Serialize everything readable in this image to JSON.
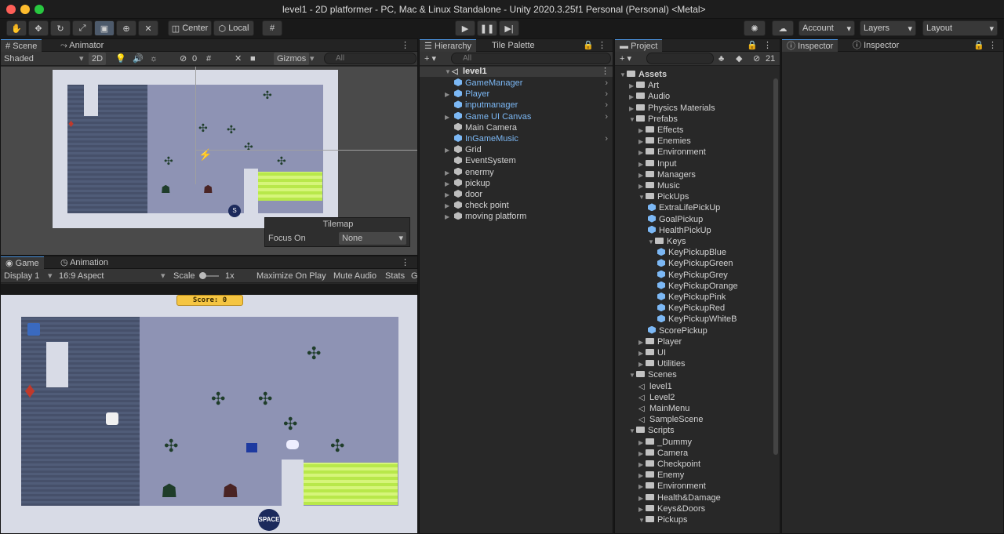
{
  "window": {
    "title": "level1 - 2D platformer - PC, Mac & Linux Standalone - Unity 2020.3.25f1 Personal (Personal) <Metal>"
  },
  "toolbar": {
    "center": "Center",
    "local": "Local",
    "account": "Account",
    "layers": "Layers",
    "layout": "Layout"
  },
  "scene": {
    "tab": "Scene",
    "tab2": "Animator",
    "shaded": "Shaded",
    "mode2d": "2D",
    "hidden_count": "0",
    "gizmos": "Gizmos",
    "search": "All",
    "tilemap": {
      "title": "Tilemap",
      "focus_label": "Focus On",
      "focus_value": "None"
    }
  },
  "game": {
    "tab": "Game",
    "tab2": "Animation",
    "display": "Display 1",
    "aspect": "16:9 Aspect",
    "scale_label": "Scale",
    "scale_value": "1x",
    "maximize": "Maximize On Play",
    "mute": "Mute Audio",
    "stats": "Stats",
    "gizmos": "Gi",
    "score": "Score: 0",
    "space": "SPACE"
  },
  "hierarchy": {
    "tab": "Hierarchy",
    "tab2": "Tile Palette",
    "search": "All",
    "scene": "level1",
    "items": [
      {
        "label": "GameManager",
        "blue": true,
        "arrow": false,
        "chev": true
      },
      {
        "label": "Player",
        "blue": true,
        "arrow": true,
        "chev": true
      },
      {
        "label": "inputmanager",
        "blue": true,
        "arrow": false,
        "chev": true
      },
      {
        "label": "Game UI Canvas",
        "blue": true,
        "arrow": true,
        "chev": true
      },
      {
        "label": "Main Camera",
        "blue": false,
        "arrow": false,
        "chev": false
      },
      {
        "label": "InGameMusic",
        "blue": true,
        "arrow": false,
        "chev": true
      },
      {
        "label": "Grid",
        "blue": false,
        "arrow": true,
        "chev": false
      },
      {
        "label": "EventSystem",
        "blue": false,
        "arrow": false,
        "chev": false
      },
      {
        "label": "enermy",
        "blue": false,
        "arrow": true,
        "chev": false
      },
      {
        "label": "pickup",
        "blue": false,
        "arrow": true,
        "chev": false
      },
      {
        "label": "door",
        "blue": false,
        "arrow": true,
        "chev": false
      },
      {
        "label": "check point",
        "blue": false,
        "arrow": true,
        "chev": false
      },
      {
        "label": "moving platform",
        "blue": false,
        "arrow": true,
        "chev": false
      }
    ]
  },
  "project": {
    "tab": "Project",
    "count": "21",
    "items": [
      {
        "label": "Assets",
        "depth": 0,
        "type": "root",
        "open": true
      },
      {
        "label": "Art",
        "depth": 1,
        "type": "folder",
        "open": false
      },
      {
        "label": "Audio",
        "depth": 1,
        "type": "folder",
        "open": false
      },
      {
        "label": "Physics Materials",
        "depth": 1,
        "type": "folder",
        "open": false
      },
      {
        "label": "Prefabs",
        "depth": 1,
        "type": "folder",
        "open": true
      },
      {
        "label": "Effects",
        "depth": 2,
        "type": "folder",
        "open": false
      },
      {
        "label": "Enemies",
        "depth": 2,
        "type": "folder",
        "open": false
      },
      {
        "label": "Environment",
        "depth": 2,
        "type": "folder",
        "open": false
      },
      {
        "label": "Input",
        "depth": 2,
        "type": "folder",
        "open": false
      },
      {
        "label": "Managers",
        "depth": 2,
        "type": "folder",
        "open": false
      },
      {
        "label": "Music",
        "depth": 2,
        "type": "folder",
        "open": false
      },
      {
        "label": "PickUps",
        "depth": 2,
        "type": "folder",
        "open": true
      },
      {
        "label": "ExtraLifePickUp",
        "depth": 3,
        "type": "prefab"
      },
      {
        "label": "GoalPickup",
        "depth": 3,
        "type": "prefab"
      },
      {
        "label": "HealthPickUp",
        "depth": 3,
        "type": "prefab"
      },
      {
        "label": "Keys",
        "depth": 3,
        "type": "folder",
        "open": true
      },
      {
        "label": "KeyPickupBlue",
        "depth": 4,
        "type": "prefab"
      },
      {
        "label": "KeyPickupGreen",
        "depth": 4,
        "type": "prefab"
      },
      {
        "label": "KeyPickupGrey",
        "depth": 4,
        "type": "prefab"
      },
      {
        "label": "KeyPickupOrange",
        "depth": 4,
        "type": "prefab"
      },
      {
        "label": "KeyPickupPink",
        "depth": 4,
        "type": "prefab"
      },
      {
        "label": "KeyPickupRed",
        "depth": 4,
        "type": "prefab"
      },
      {
        "label": "KeyPickupWhiteB",
        "depth": 4,
        "type": "prefab"
      },
      {
        "label": "ScorePickup",
        "depth": 3,
        "type": "prefab"
      },
      {
        "label": "Player",
        "depth": 2,
        "type": "folder",
        "open": false
      },
      {
        "label": "UI",
        "depth": 2,
        "type": "folder",
        "open": false
      },
      {
        "label": "Utilities",
        "depth": 2,
        "type": "folder",
        "open": false
      },
      {
        "label": "Scenes",
        "depth": 1,
        "type": "folder",
        "open": true
      },
      {
        "label": "level1",
        "depth": 2,
        "type": "scene"
      },
      {
        "label": "Level2",
        "depth": 2,
        "type": "scene"
      },
      {
        "label": "MainMenu",
        "depth": 2,
        "type": "scene"
      },
      {
        "label": "SampleScene",
        "depth": 2,
        "type": "scene"
      },
      {
        "label": "Scripts",
        "depth": 1,
        "type": "folder",
        "open": true
      },
      {
        "label": "_Dummy",
        "depth": 2,
        "type": "folder",
        "open": false
      },
      {
        "label": "Camera",
        "depth": 2,
        "type": "folder",
        "open": false
      },
      {
        "label": "Checkpoint",
        "depth": 2,
        "type": "folder",
        "open": false
      },
      {
        "label": "Enemy",
        "depth": 2,
        "type": "folder",
        "open": false
      },
      {
        "label": "Environment",
        "depth": 2,
        "type": "folder",
        "open": false
      },
      {
        "label": "Health&Damage",
        "depth": 2,
        "type": "folder",
        "open": false
      },
      {
        "label": "Keys&Doors",
        "depth": 2,
        "type": "folder",
        "open": false
      },
      {
        "label": "Pickups",
        "depth": 2,
        "type": "folder",
        "open": true
      }
    ]
  },
  "inspector": {
    "tab1": "Inspector",
    "tab2": "Inspector"
  }
}
